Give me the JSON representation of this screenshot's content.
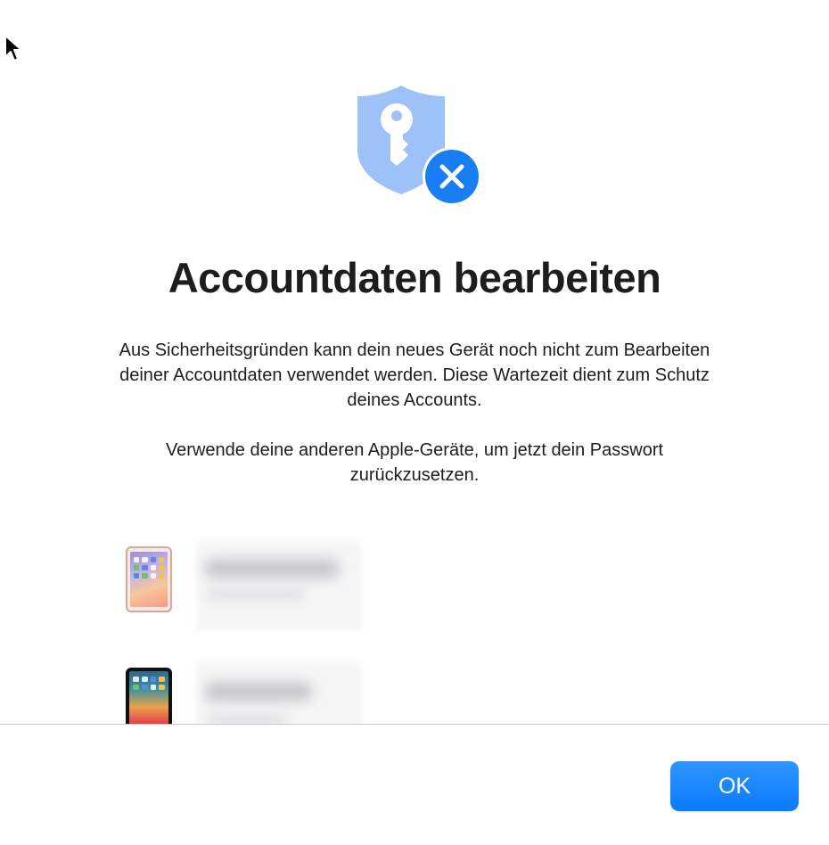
{
  "dialog": {
    "title": "Accountdaten bearbeiten",
    "message_1": "Aus Sicherheitsgründen kann dein neues Gerät noch nicht zum Bearbeiten deiner Accountdaten verwendet werden. Diese Wartezeit dient zum Schutz deines Accounts.",
    "message_2": "Verwende deine anderen Apple-Geräte, um jetzt dein Passwort zurückzusetzen.",
    "hero_icon": "shield-key-x-icon",
    "ok_label": "OK"
  },
  "devices": [
    {
      "icon": "ipad-light-icon"
    },
    {
      "icon": "ipad-dark-icon"
    }
  ],
  "colors": {
    "accent": "#0a7bff",
    "shield": "#9ec2f7",
    "badge": "#1a7ef3",
    "title_text": "#1d1d1f"
  }
}
